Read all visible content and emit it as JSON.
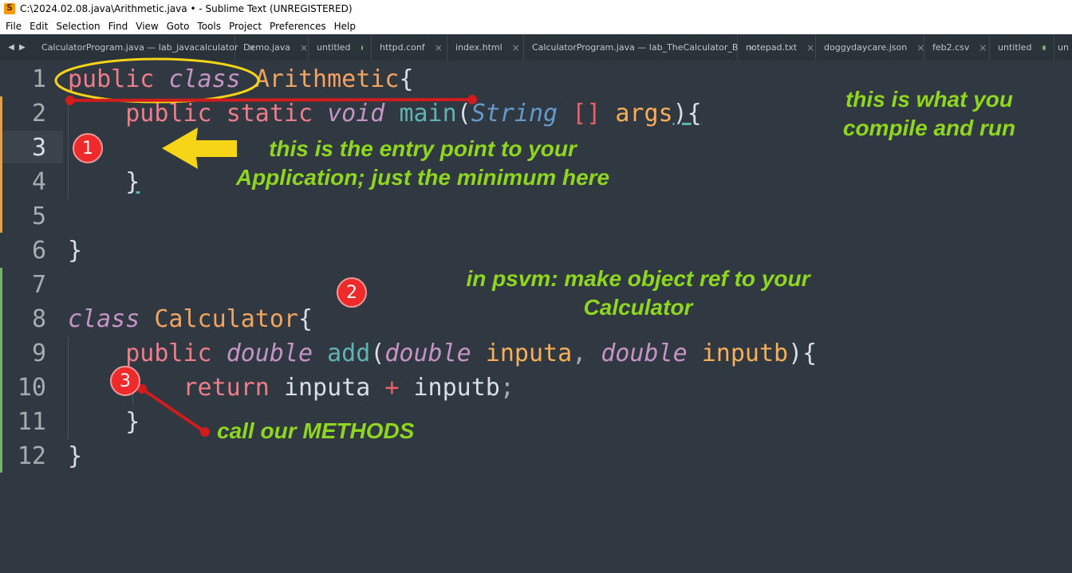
{
  "window": {
    "title": "C:\\2024.02.08.java\\Arithmetic.java • - Sublime Text (UNREGISTERED)"
  },
  "menu": [
    "File",
    "Edit",
    "Selection",
    "Find",
    "View",
    "Goto",
    "Tools",
    "Project",
    "Preferences",
    "Help"
  ],
  "tabs": [
    {
      "label": "CalculatorProgram.java — lab_javacalculator",
      "state": "close"
    },
    {
      "label": "Demo.java",
      "state": "close"
    },
    {
      "label": "untitled",
      "state": "dirty"
    },
    {
      "label": "httpd.conf",
      "state": "close"
    },
    {
      "label": "index.html",
      "state": "close"
    },
    {
      "label": "CalculatorProgram.java — lab_TheCalculator_B",
      "state": "close"
    },
    {
      "label": "notepad.txt",
      "state": "close"
    },
    {
      "label": "doggydaycare.json",
      "state": "close"
    },
    {
      "label": "feb2.csv",
      "state": "close"
    },
    {
      "label": "untitled",
      "state": "dirty"
    },
    {
      "label": "un",
      "state": "none"
    }
  ],
  "line_numbers": [
    "1",
    "2",
    "3",
    "4",
    "5",
    "6",
    "7",
    "8",
    "9",
    "10",
    "11",
    "12"
  ],
  "code": {
    "l1": {
      "public": "public",
      "class": "class",
      "name": "Arithmetic",
      "brace": "{"
    },
    "l2": {
      "public": "public",
      "static": "static",
      "void": "void",
      "main": "main",
      "paren": "(",
      "String": "String",
      "brackets": "[]",
      "args": "args",
      "close": "){"
    },
    "l4": {
      "brace": "}"
    },
    "l6": {
      "brace": "}"
    },
    "l8": {
      "class": "class",
      "name": "Calculator",
      "brace": "{"
    },
    "l9": {
      "public": "public",
      "double1": "double",
      "add": "add",
      "paren": "(",
      "double2": "double",
      "inputa": "inputa",
      "comma": ",",
      "double3": "double",
      "inputb": "inputb",
      "close": "){"
    },
    "l10": {
      "return": "return",
      "inputa": "inputa",
      "plus": "+",
      "inputb": "inputb",
      "semi": ";"
    },
    "l11": {
      "brace": "}"
    },
    "l12": {
      "brace": "}"
    }
  },
  "annotations": {
    "compile_run": [
      "this is what you",
      "compile and run"
    ],
    "entry_point": [
      "this is the entry point to your",
      "Application; just the minimum here"
    ],
    "psvm": [
      "in psvm: make object ref to your",
      "Calculator"
    ],
    "methods": "call our METHODS",
    "badges": [
      "1",
      "2",
      "3"
    ]
  },
  "colors": {
    "editor_bg": "#303841",
    "annotation_green": "#8fd71d",
    "arrow_yellow": "#f6d416",
    "marker_red": "#d01c1c",
    "diff_modified": "#e59f4a",
    "diff_added": "#76b36a"
  }
}
